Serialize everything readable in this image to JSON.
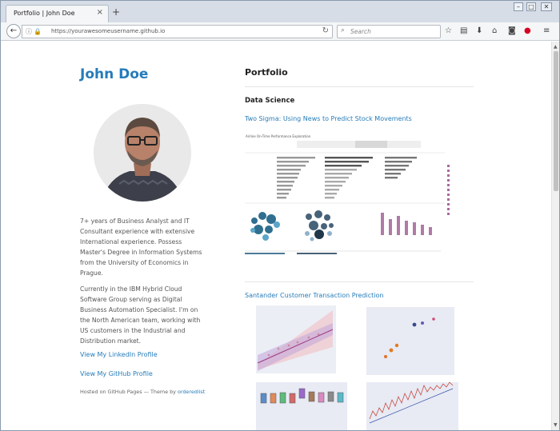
{
  "browser": {
    "tab_title": "Portfolio | John Doe",
    "tab_close": "×",
    "new_tab": "+",
    "url": "https://yourawesomeusername.github.io",
    "search_placeholder": "Search",
    "window_controls": {
      "minimize": "–",
      "maximize": "□",
      "close": "✕"
    },
    "icons": [
      "bookmark-star-icon",
      "library-icon",
      "download-icon",
      "home-icon",
      "pocket-icon",
      "addon-icon",
      "menu-icon"
    ]
  },
  "sidebar": {
    "name": "John Doe",
    "bio_1": "7+ years of Business Analyst and IT Consultant experience with extensive International experience. Possess Master's Degree in Information Systems from the University of Economics in Prague.",
    "bio_2": "Currently in the IBM Hybrid Cloud Software Group serving as Digital Business Automation Specialist. I'm on the North American team, working with US customers in the Industrial and Distribution market.",
    "linkedin": "View My LinkedIn Profile",
    "github": "View My GitHub Profile",
    "footer_prefix": "Hosted on GitHub Pages — Theme by ",
    "footer_theme": "orderedlist"
  },
  "main": {
    "heading": "Portfolio",
    "section": "Data Science",
    "projects": [
      {
        "title": "Two Sigma: Using News to Predict Stock Movements"
      },
      {
        "title": "Santander Customer Transaction Prediction"
      }
    ],
    "dashboard_title": "Airline On-Time Performance Exploration"
  },
  "colors": {
    "accent": "#267cb9",
    "text": "#555555",
    "heading": "#222222"
  }
}
